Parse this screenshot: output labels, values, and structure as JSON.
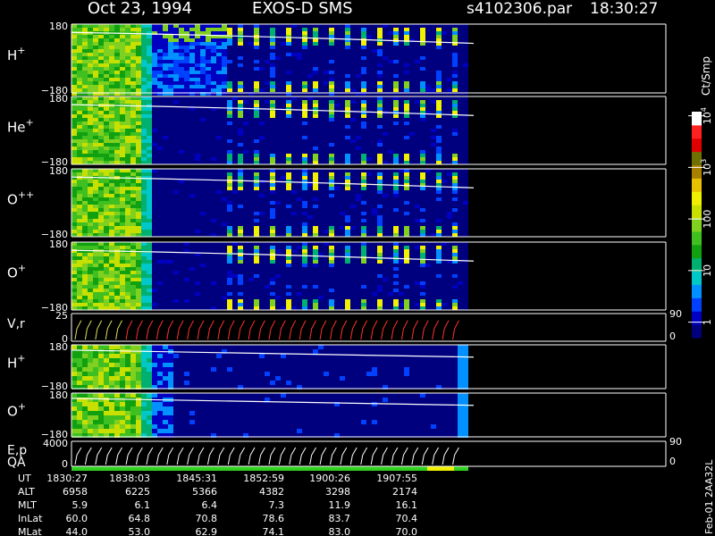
{
  "header": {
    "date": "Oct 23, 1994",
    "instrument": "EXOS-D SMS",
    "file": "s4102306.par",
    "time": "18:30:27"
  },
  "colorbar": {
    "unit": "Ct/Smp",
    "ticks": [
      {
        "label": "1",
        "value": 1
      },
      {
        "label": "10",
        "value": 10
      },
      {
        "label": "100",
        "value": 100
      },
      {
        "label": "10",
        "exp": "3",
        "value": 1000
      },
      {
        "label": "10",
        "exp": "4",
        "value": 10000
      }
    ],
    "colors": [
      "#00007f",
      "#0000c0",
      "#0040ff",
      "#0090ff",
      "#00c8c8",
      "#00b070",
      "#10a010",
      "#40c020",
      "#80d020",
      "#c8e000",
      "#f0f000",
      "#e8c000",
      "#a88000",
      "#707000",
      "#e00000",
      "#ff2020",
      "#ffffff"
    ]
  },
  "chart_data": {
    "type": "heatmap",
    "x_ticks": [
      "1830:27",
      "1838:03",
      "1845:31",
      "1852:59",
      "1900:26",
      "1907:55"
    ],
    "panels": [
      {
        "label": "H",
        "sup": "+",
        "ylim": [
          -180,
          180
        ],
        "y_ticks": [
          "180",
          "−180"
        ]
      },
      {
        "label": "He",
        "sup": "+",
        "ylim": [
          -180,
          180
        ],
        "y_ticks": [
          "180",
          "−180"
        ]
      },
      {
        "label": "O",
        "sup": "++",
        "ylim": [
          -180,
          180
        ],
        "y_ticks": [
          "180",
          "−180"
        ]
      },
      {
        "label": "O",
        "sup": "+",
        "ylim": [
          -180,
          180
        ],
        "y_ticks": [
          "180",
          "−180"
        ]
      },
      {
        "label": "V,r",
        "sup": "",
        "ylim": [
          0,
          25
        ],
        "y_ticks": [
          "25",
          "0"
        ],
        "right_ticks": [
          "90",
          "0"
        ]
      },
      {
        "label": "H",
        "sup": "+",
        "ylim": [
          -180,
          180
        ],
        "y_ticks": [
          "180",
          "−180"
        ]
      },
      {
        "label": "O",
        "sup": "+",
        "ylim": [
          -180,
          180
        ],
        "y_ticks": [
          "180",
          "−180"
        ]
      },
      {
        "label": "E,p",
        "sup": "",
        "ylim": [
          0,
          4000
        ],
        "y_ticks": [
          "4000",
          "0"
        ],
        "right_ticks": [
          "90",
          "0"
        ]
      }
    ],
    "qa_label": "QA",
    "ephemeris": [
      {
        "name": "UT",
        "values": [
          "1830:27",
          "1838:03",
          "1845:31",
          "1852:59",
          "1900:26",
          "1907:55"
        ]
      },
      {
        "name": "ALT",
        "values": [
          "6958",
          "6225",
          "5366",
          "4382",
          "3298",
          "2174"
        ]
      },
      {
        "name": "MLT",
        "values": [
          "5.9",
          "6.1",
          "6.4",
          "7.3",
          "11.9",
          "16.1"
        ]
      },
      {
        "name": "InLat",
        "values": [
          "60.0",
          "64.8",
          "70.8",
          "78.6",
          "83.7",
          "70.4"
        ]
      },
      {
        "name": "MLat",
        "values": [
          "44.0",
          "53.0",
          "62.9",
          "74.1",
          "83.0",
          "70.0"
        ]
      }
    ],
    "side_label": "Feb-01 2AA32L"
  }
}
